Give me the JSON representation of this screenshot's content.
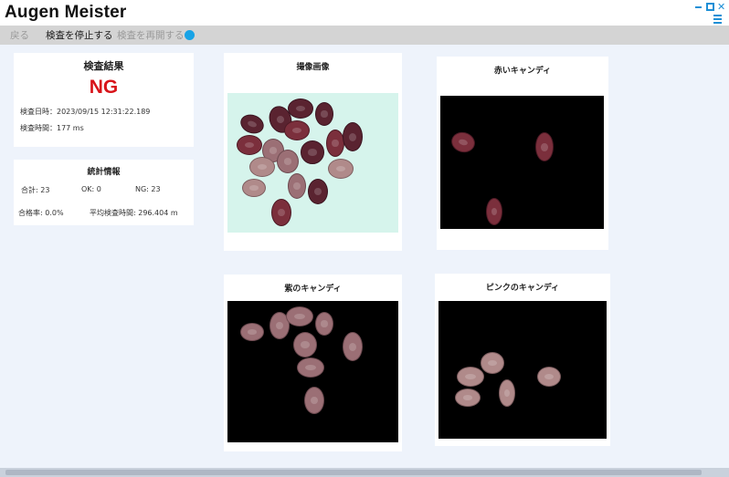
{
  "app": {
    "title": "Augen Meister"
  },
  "window_controls": {
    "close_glyph": "✕"
  },
  "toolbar": {
    "back_label": "戻る",
    "stop_label": "検査を停止する",
    "resume_label": "検査を再開する",
    "status_color": "#18a3e6"
  },
  "result": {
    "title": "検査結果",
    "value": "NG",
    "value_color": "#d8141a",
    "datetime": "検査日時：2023/09/15 12:31:22.189",
    "duration": "検査時間：177 ms"
  },
  "stats": {
    "title": "統計情報",
    "total": "合計: 23",
    "ok": "OK: 0",
    "ng": "NG: 23",
    "pass_rate": "合格率: 0.0%",
    "avg_time": "平均検査時間: 296.404 m"
  },
  "images": {
    "captured": "撮像画像",
    "red": "赤いキャンディ",
    "purple": "紫のキャンディ",
    "pink": "ピンクのキャンディ"
  }
}
